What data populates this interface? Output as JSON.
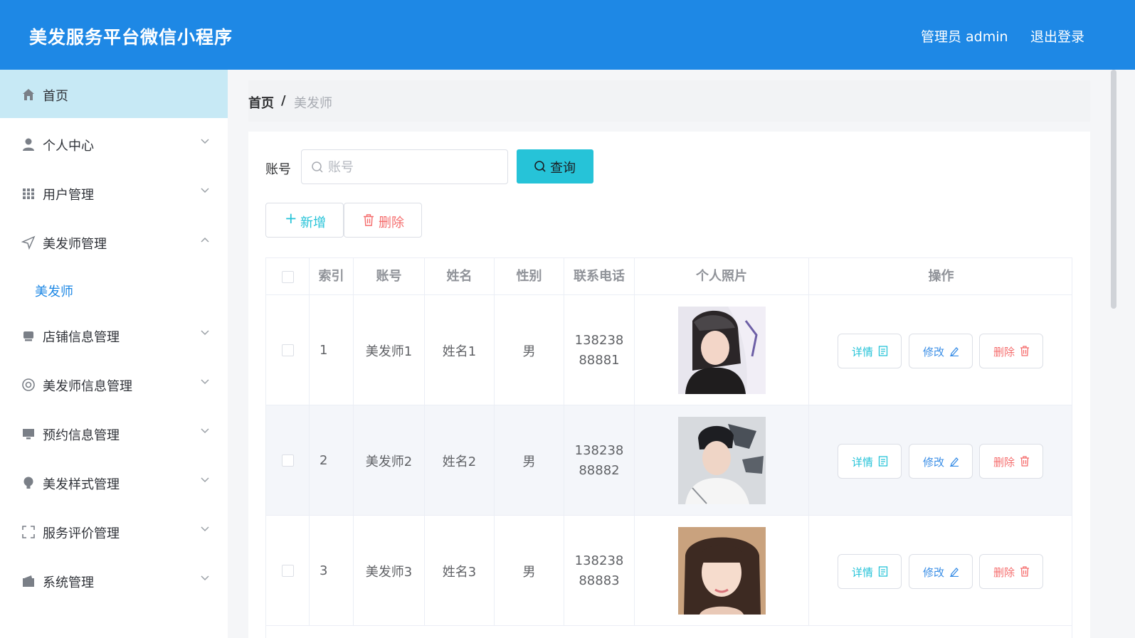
{
  "header": {
    "title": "美发服务平台微信小程序",
    "admin_label": "管理员 admin",
    "logout_label": "退出登录",
    "bg_color": "#1e88e5"
  },
  "sidebar": {
    "items": [
      {
        "label": "首页",
        "icon": "home-icon",
        "active": true
      },
      {
        "label": "个人中心",
        "icon": "user-icon"
      },
      {
        "label": "用户管理",
        "icon": "grid-icon"
      },
      {
        "label": "美发师管理",
        "icon": "navigation-icon",
        "expanded": true
      },
      {
        "label": "店铺信息管理",
        "icon": "shop-icon"
      },
      {
        "label": "美发师信息管理",
        "icon": "lifebuoy-icon"
      },
      {
        "label": "预约信息管理",
        "icon": "monitor-icon"
      },
      {
        "label": "美发样式管理",
        "icon": "bulb-icon"
      },
      {
        "label": "服务评价管理",
        "icon": "fullscreen-icon"
      },
      {
        "label": "系统管理",
        "icon": "wallet-icon"
      }
    ],
    "sub_item": "美发师"
  },
  "breadcrumb": {
    "home": "首页",
    "separator": "/",
    "current": "美发师"
  },
  "search": {
    "label": "账号",
    "placeholder": "账号",
    "value": "",
    "button_label": "查询"
  },
  "actions": {
    "add_label": "新增",
    "delete_label": "删除"
  },
  "table": {
    "columns": [
      "索引",
      "账号",
      "姓名",
      "性别",
      "联系电话",
      "个人照片",
      "操作"
    ],
    "rows": [
      {
        "index": "1",
        "account": "美发师1",
        "name": "姓名1",
        "gender": "男",
        "phone": "13823888881"
      },
      {
        "index": "2",
        "account": "美发师2",
        "name": "姓名2",
        "gender": "男",
        "phone": "13823888882"
      },
      {
        "index": "3",
        "account": "美发师3",
        "name": "姓名3",
        "gender": "男",
        "phone": "13823888883"
      }
    ],
    "row_actions": {
      "detail": "详情",
      "edit": "修改",
      "delete": "删除"
    }
  },
  "colors": {
    "accent": "#26c3d8",
    "primary": "#1e88e5",
    "danger": "#f56c6c",
    "active_menu_bg": "#c7e9f5"
  }
}
